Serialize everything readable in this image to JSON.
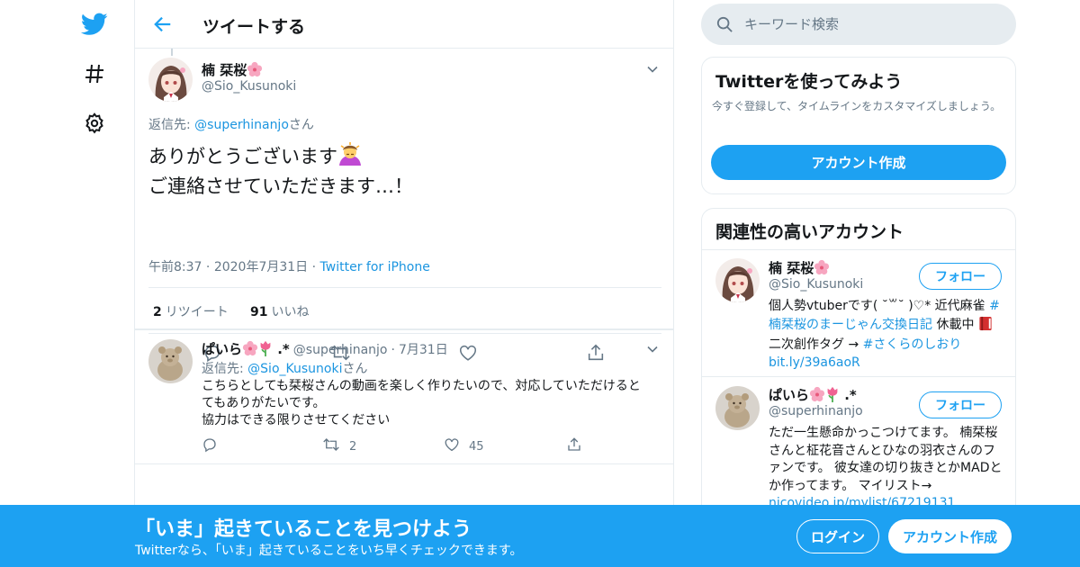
{
  "header": {
    "title": "ツイートする"
  },
  "search": {
    "placeholder": "キーワード検索"
  },
  "tweet": {
    "name": "楠 栞桜",
    "handle": "@Sio_Kusunoki",
    "reply_prefix": "返信先: ",
    "reply_to": "@superhinanjo",
    "reply_suffix": "さん",
    "line1": "ありがとうございます",
    "line2": "ご連絡させていただきます…！",
    "time": "午前8:37",
    "date": "2020年7月31日",
    "source": "Twitter for iPhone",
    "retweet_count": "2",
    "retweet_label": "リツイート",
    "like_count": "91",
    "like_label": "いいね"
  },
  "reply": {
    "name": "ぱいら",
    "name_suffix": " .*",
    "handle": "@superhinanjo",
    "date": "7月31日",
    "reply_prefix": "返信先: ",
    "reply_to": "@Sio_Kusunoki",
    "reply_suffix": "さん",
    "text1": "こちらとしても栞桜さんの動画を楽しく作りたいので、対応していただけるとてもありがたいです。",
    "text2": "協力はできる限りさせてください",
    "retweet_count": "2",
    "like_count": "45"
  },
  "signup_card": {
    "title": "Twitterを使ってみよう",
    "desc": "今すぐ登録して、タイムラインをカスタマイズしましょう。",
    "button": "アカウント作成"
  },
  "related": {
    "title": "関連性の高いアカウント",
    "accounts": [
      {
        "name": "楠 栞桜",
        "handle": "@Sio_Kusunoki",
        "follow": "フォロー",
        "bio_a": "個人勢vtuberです( ˘꒳˘ )♡* 近代麻雀 ",
        "bio_tag1": "#楠栞桜のまーじゃん交換日記",
        "bio_b": " 休載中 ",
        "bio_c": " 二次創作タグ → ",
        "bio_tag2": "#さくらのしおり",
        "bio_link": "bit.ly/39a6aoR"
      },
      {
        "name": "ぱいら",
        "name_suffix": " .*",
        "handle": "@superhinanjo",
        "follow": "フォロー",
        "bio_a": "ただ一生懸命かっこつけてます。 楠栞桜さんと柾花音さんとひなの羽衣さんのファンです。 彼女達の切り抜きとかMADとか作ってます。 マイリスト→ ",
        "bio_link": "nicovideo.jp/mylist/67219131"
      }
    ]
  },
  "banner": {
    "title": "「いま」起きていることを見つけよう",
    "sub": "Twitterなら、「いま」起きていることをいち早くチェックできます。",
    "login": "ログイン",
    "signup": "アカウント作成"
  },
  "colors": {
    "accent": "#1da1f2",
    "link": "#1b95e0",
    "muted": "#657786"
  },
  "icons": [
    "twitter-logo-icon",
    "hashtag-icon",
    "gear-icon",
    "back-arrow-icon",
    "chevron-down-icon",
    "reply-icon",
    "retweet-icon",
    "heart-icon",
    "share-icon",
    "search-icon",
    "cherry-blossom-icon",
    "tulip-icon",
    "person-bowing-icon",
    "red-book-icon"
  ]
}
